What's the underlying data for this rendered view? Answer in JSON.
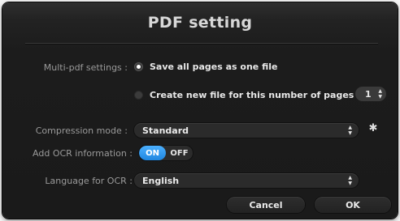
{
  "dialog": {
    "title": "PDF setting"
  },
  "multi_pdf": {
    "label": "Multi-pdf settings :",
    "option_all": "Save all pages as one file",
    "option_split": "Create new file for this number of pages",
    "selected": "option_all",
    "pages_value": "1"
  },
  "compression": {
    "label": "Compression mode :",
    "value": "Standard"
  },
  "ocr": {
    "label": "Add OCR information :",
    "on_label": "ON",
    "off_label": "OFF",
    "state": "ON"
  },
  "language": {
    "label": "Language for OCR :",
    "value": "English"
  },
  "buttons": {
    "cancel": "Cancel",
    "ok": "OK"
  },
  "icons": {
    "stepper": "up-down-arrows-icon",
    "select": "up-down-arrows-icon",
    "settings": "gear-icon"
  },
  "colors": {
    "accent": "#2e9bf0",
    "background": "#1c1c1c"
  }
}
